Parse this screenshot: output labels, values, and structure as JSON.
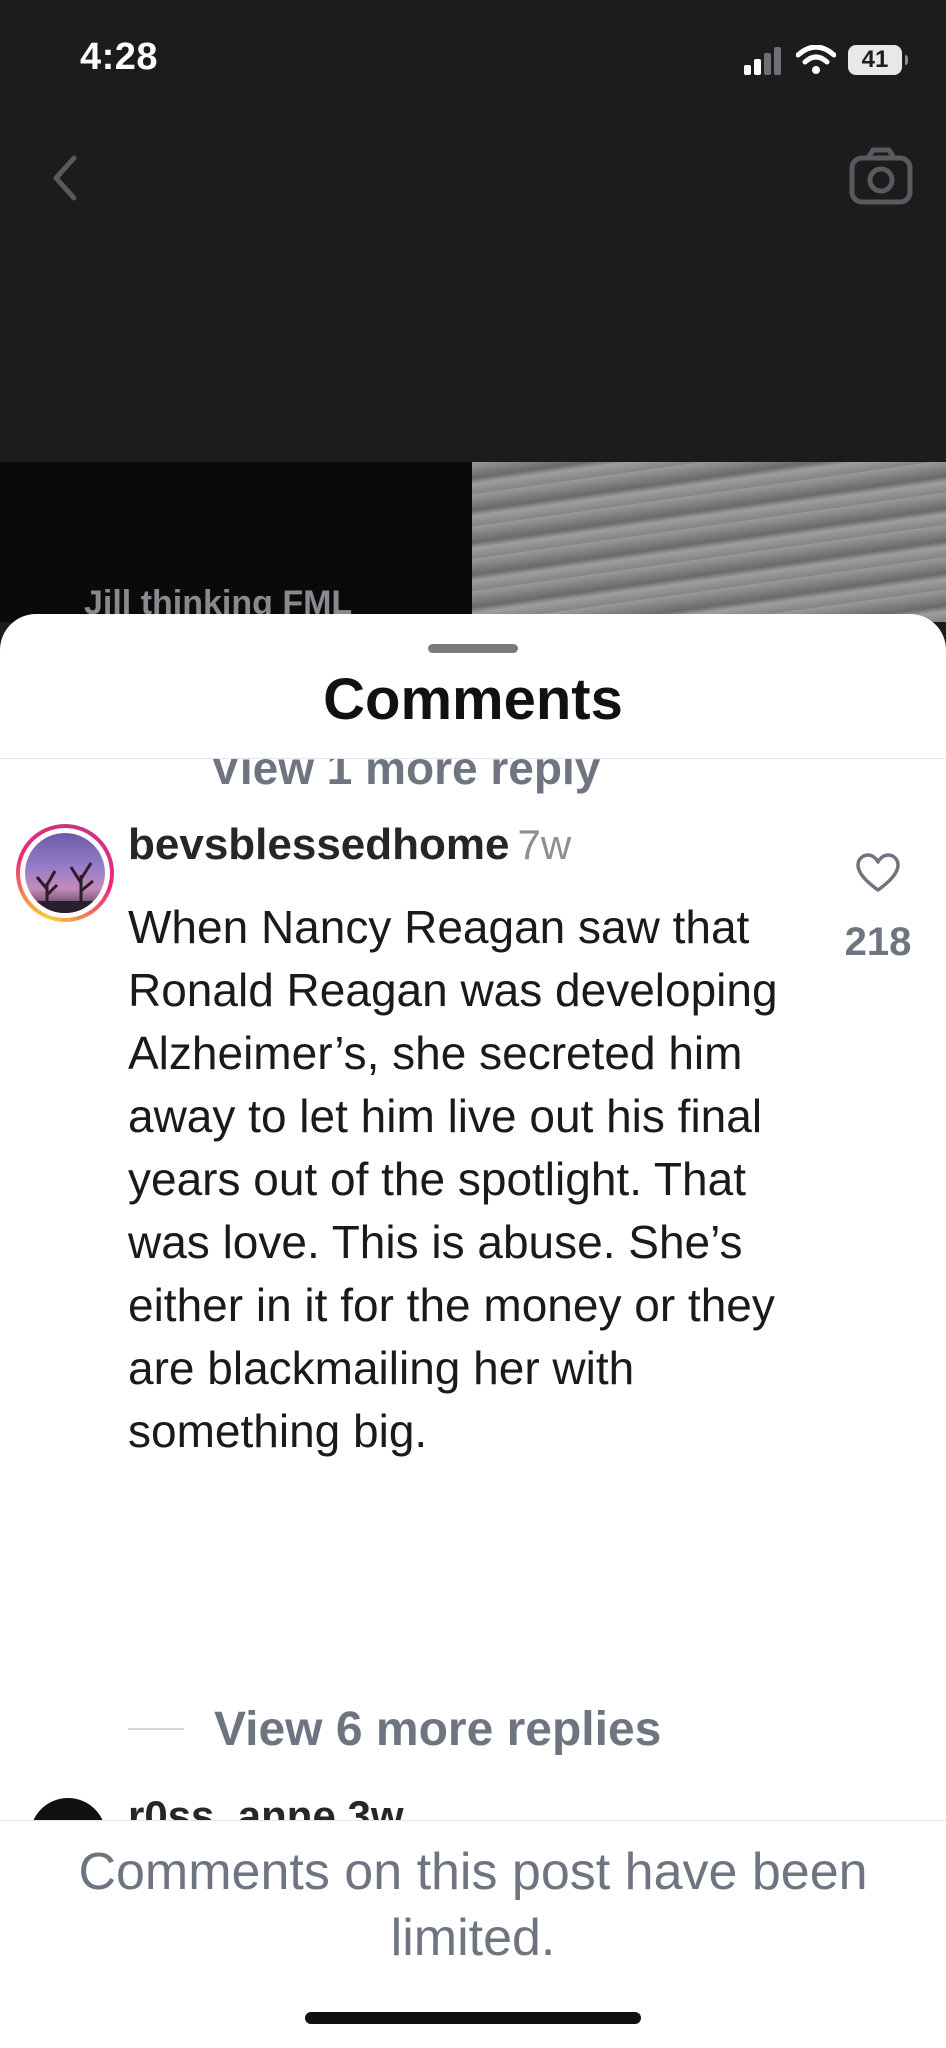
{
  "status_bar": {
    "time": "4:28",
    "battery": "41",
    "icons": [
      "signal-icon",
      "wifi-icon",
      "battery-icon"
    ]
  },
  "top_nav": {
    "icons": [
      "chevron-left-icon",
      "camera-icon"
    ]
  },
  "media": {
    "caption_partial": "Jill thinking FML"
  },
  "sheet": {
    "title": "Comments",
    "clipped_reply_label": "View 1 more reply"
  },
  "comment": {
    "username": "bevsblessedhome",
    "time": "7w",
    "text": "When Nancy Reagan saw that Ronald Reagan was developing Alzheimer’s, she secreted him away to let him live out his final years out of the spotlight. That was love. This is abuse. She’s either in it for the money or they are blackmailing her with something big.",
    "likes": "218",
    "view_replies": "View 6 more replies"
  },
  "next_comment": {
    "username_partial": "r0ss_anne 3w"
  },
  "footer": {
    "limited_notice": "Comments on this post have been limited."
  },
  "colors": {
    "background_dark": "#1c1c1e",
    "sheet": "#ffffff",
    "muted_text": "#6f7580",
    "body_text": "#1a1a1a"
  }
}
